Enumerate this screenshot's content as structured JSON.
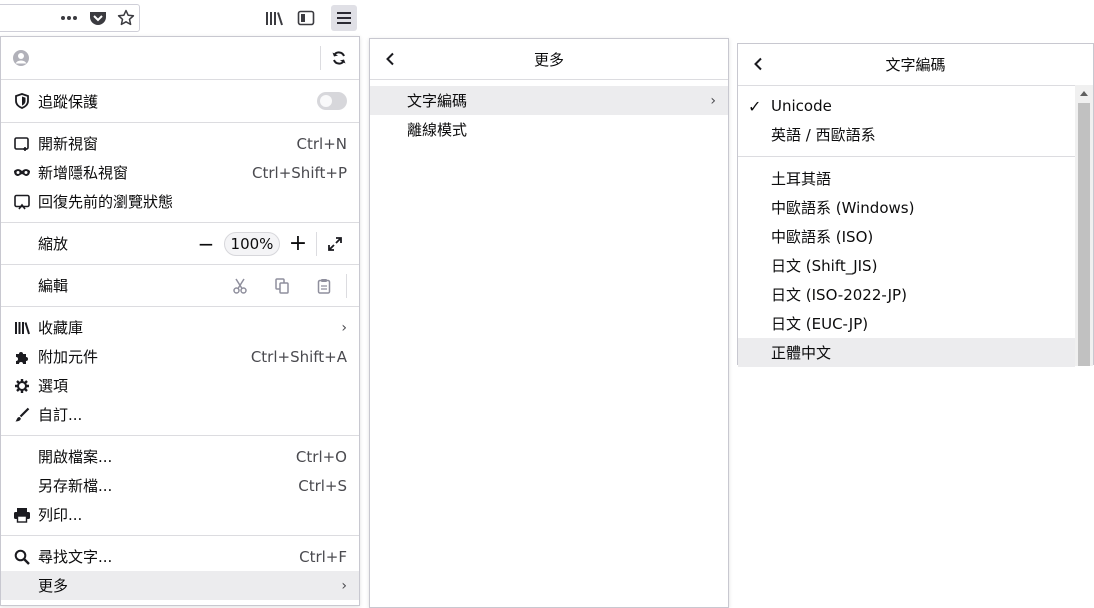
{
  "toolbar": {
    "icons": [
      "more-dots-icon",
      "pocket-icon",
      "bookmark-star-icon",
      "library-icon",
      "sidebar-icon",
      "hamburger-menu-icon"
    ]
  },
  "main_menu": {
    "tracking_label": "追蹤保護",
    "items_group1": [
      {
        "label": "開新視窗",
        "accel": "Ctrl+N",
        "icon": "new-window-icon"
      },
      {
        "label": "新增隱私視窗",
        "accel": "Ctrl+Shift+P",
        "icon": "private-mask-icon"
      },
      {
        "label": "回復先前的瀏覽狀態",
        "accel": "",
        "icon": "restore-session-icon"
      }
    ],
    "zoom": {
      "label": "縮放",
      "minus": "−",
      "value": "100%",
      "plus": "+"
    },
    "edit_label": "編輯",
    "items_group2": [
      {
        "label": "收藏庫",
        "accel": "›",
        "icon": "library-icon"
      },
      {
        "label": "附加元件",
        "accel": "Ctrl+Shift+A",
        "icon": "puzzle-icon"
      },
      {
        "label": "選項",
        "accel": "",
        "icon": "gear-icon"
      },
      {
        "label": "自訂...",
        "accel": "",
        "icon": "paintbrush-icon"
      }
    ],
    "items_group3": [
      {
        "label": "開啟檔案...",
        "accel": "Ctrl+O"
      },
      {
        "label": "另存新檔...",
        "accel": "Ctrl+S"
      },
      {
        "label": "列印...",
        "accel": "",
        "icon": "printer-icon"
      }
    ],
    "items_group4": [
      {
        "label": "尋找文字...",
        "accel": "Ctrl+F",
        "icon": "search-icon"
      },
      {
        "label": "更多",
        "accel": "›"
      }
    ]
  },
  "more_menu": {
    "title": "更多",
    "items": [
      {
        "label": "文字編碼",
        "chev": "›"
      },
      {
        "label": "離線模式",
        "chev": ""
      }
    ]
  },
  "encoding_menu": {
    "title": "文字編碼",
    "checkmark": "✓",
    "top_items": [
      "Unicode",
      "英語 / 西歐語系"
    ],
    "items": [
      "土耳其語",
      "中歐語系 (Windows)",
      "中歐語系 (ISO)",
      "日文 (Shift_JIS)",
      "日文 (ISO-2022-JP)",
      "日文 (EUC-JP)",
      "正體中文"
    ]
  },
  "colors": {
    "highlight": "#ececee",
    "border": "#c8c8d0",
    "text": "#0c0c0d"
  }
}
